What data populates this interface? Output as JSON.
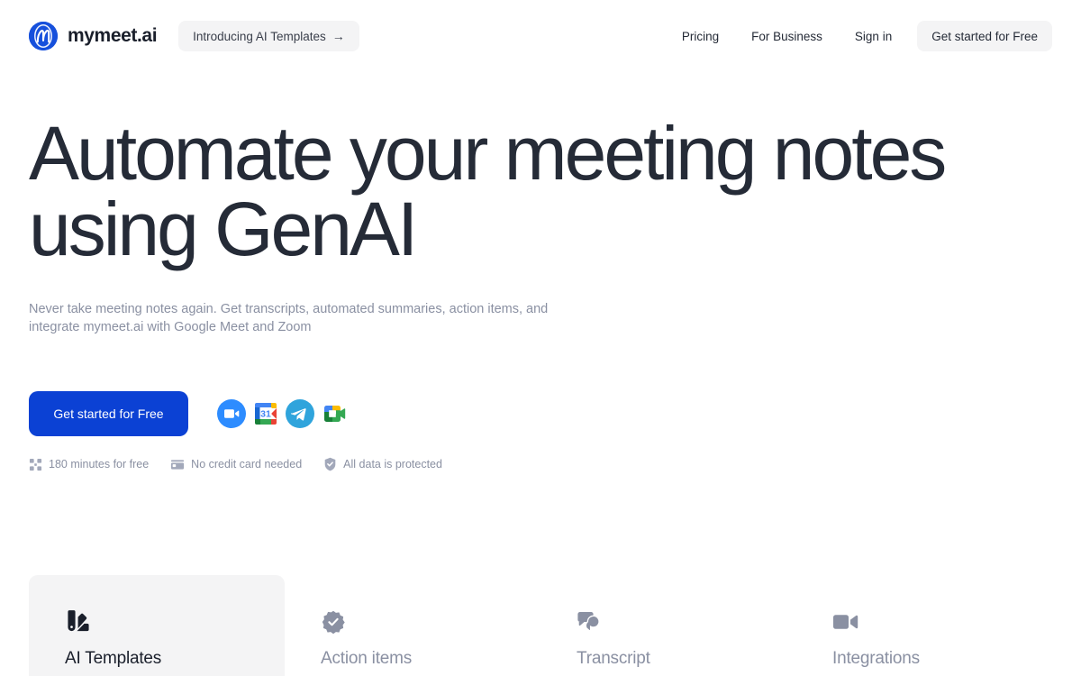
{
  "brand": {
    "name": "mymeet.ai",
    "logo_icon": "mymeet-circle-m-logo",
    "logo_color": "#1650DC"
  },
  "navbar": {
    "announcement": {
      "label": "Introducing AI Templates",
      "arrow": "→"
    },
    "links": [
      {
        "label": "Pricing"
      },
      {
        "label": "For Business"
      },
      {
        "label": "Sign in"
      }
    ],
    "cta_label": "Get started for Free"
  },
  "hero": {
    "title": "Automate your meeting notes using GenAI",
    "subtitle": "Never take meeting notes again. Get transcripts, automated summaries, action items, and integrate mymeet.ai with Google Meet and Zoom",
    "cta_label": "Get started for Free",
    "cta_color": "#0B41D4",
    "integrations": [
      {
        "name": "zoom-icon",
        "label": "Zoom"
      },
      {
        "name": "google-calendar-icon",
        "label": "Google Calendar"
      },
      {
        "name": "telegram-icon",
        "label": "Telegram"
      },
      {
        "name": "google-meet-icon",
        "label": "Google Meet"
      }
    ]
  },
  "badges": [
    {
      "icon": "timer-icon",
      "label": "180 minutes for free"
    },
    {
      "icon": "credit-card-icon",
      "label": "No credit card needed"
    },
    {
      "icon": "shield-check-icon",
      "label": "All data is protected"
    }
  ],
  "tabs": [
    {
      "icon": "palette-icon",
      "label": "AI Templates",
      "active": true
    },
    {
      "icon": "check-badge-icon",
      "label": "Action items",
      "active": false
    },
    {
      "icon": "chat-bubbles-icon",
      "label": "Transcript",
      "active": false
    },
    {
      "icon": "video-camera-icon",
      "label": "Integrations",
      "active": false
    }
  ],
  "colors": {
    "text_dark": "#252B37",
    "text_muted": "#8A90A2",
    "surface": "#F4F4F5",
    "accent": "#0B41D4"
  }
}
